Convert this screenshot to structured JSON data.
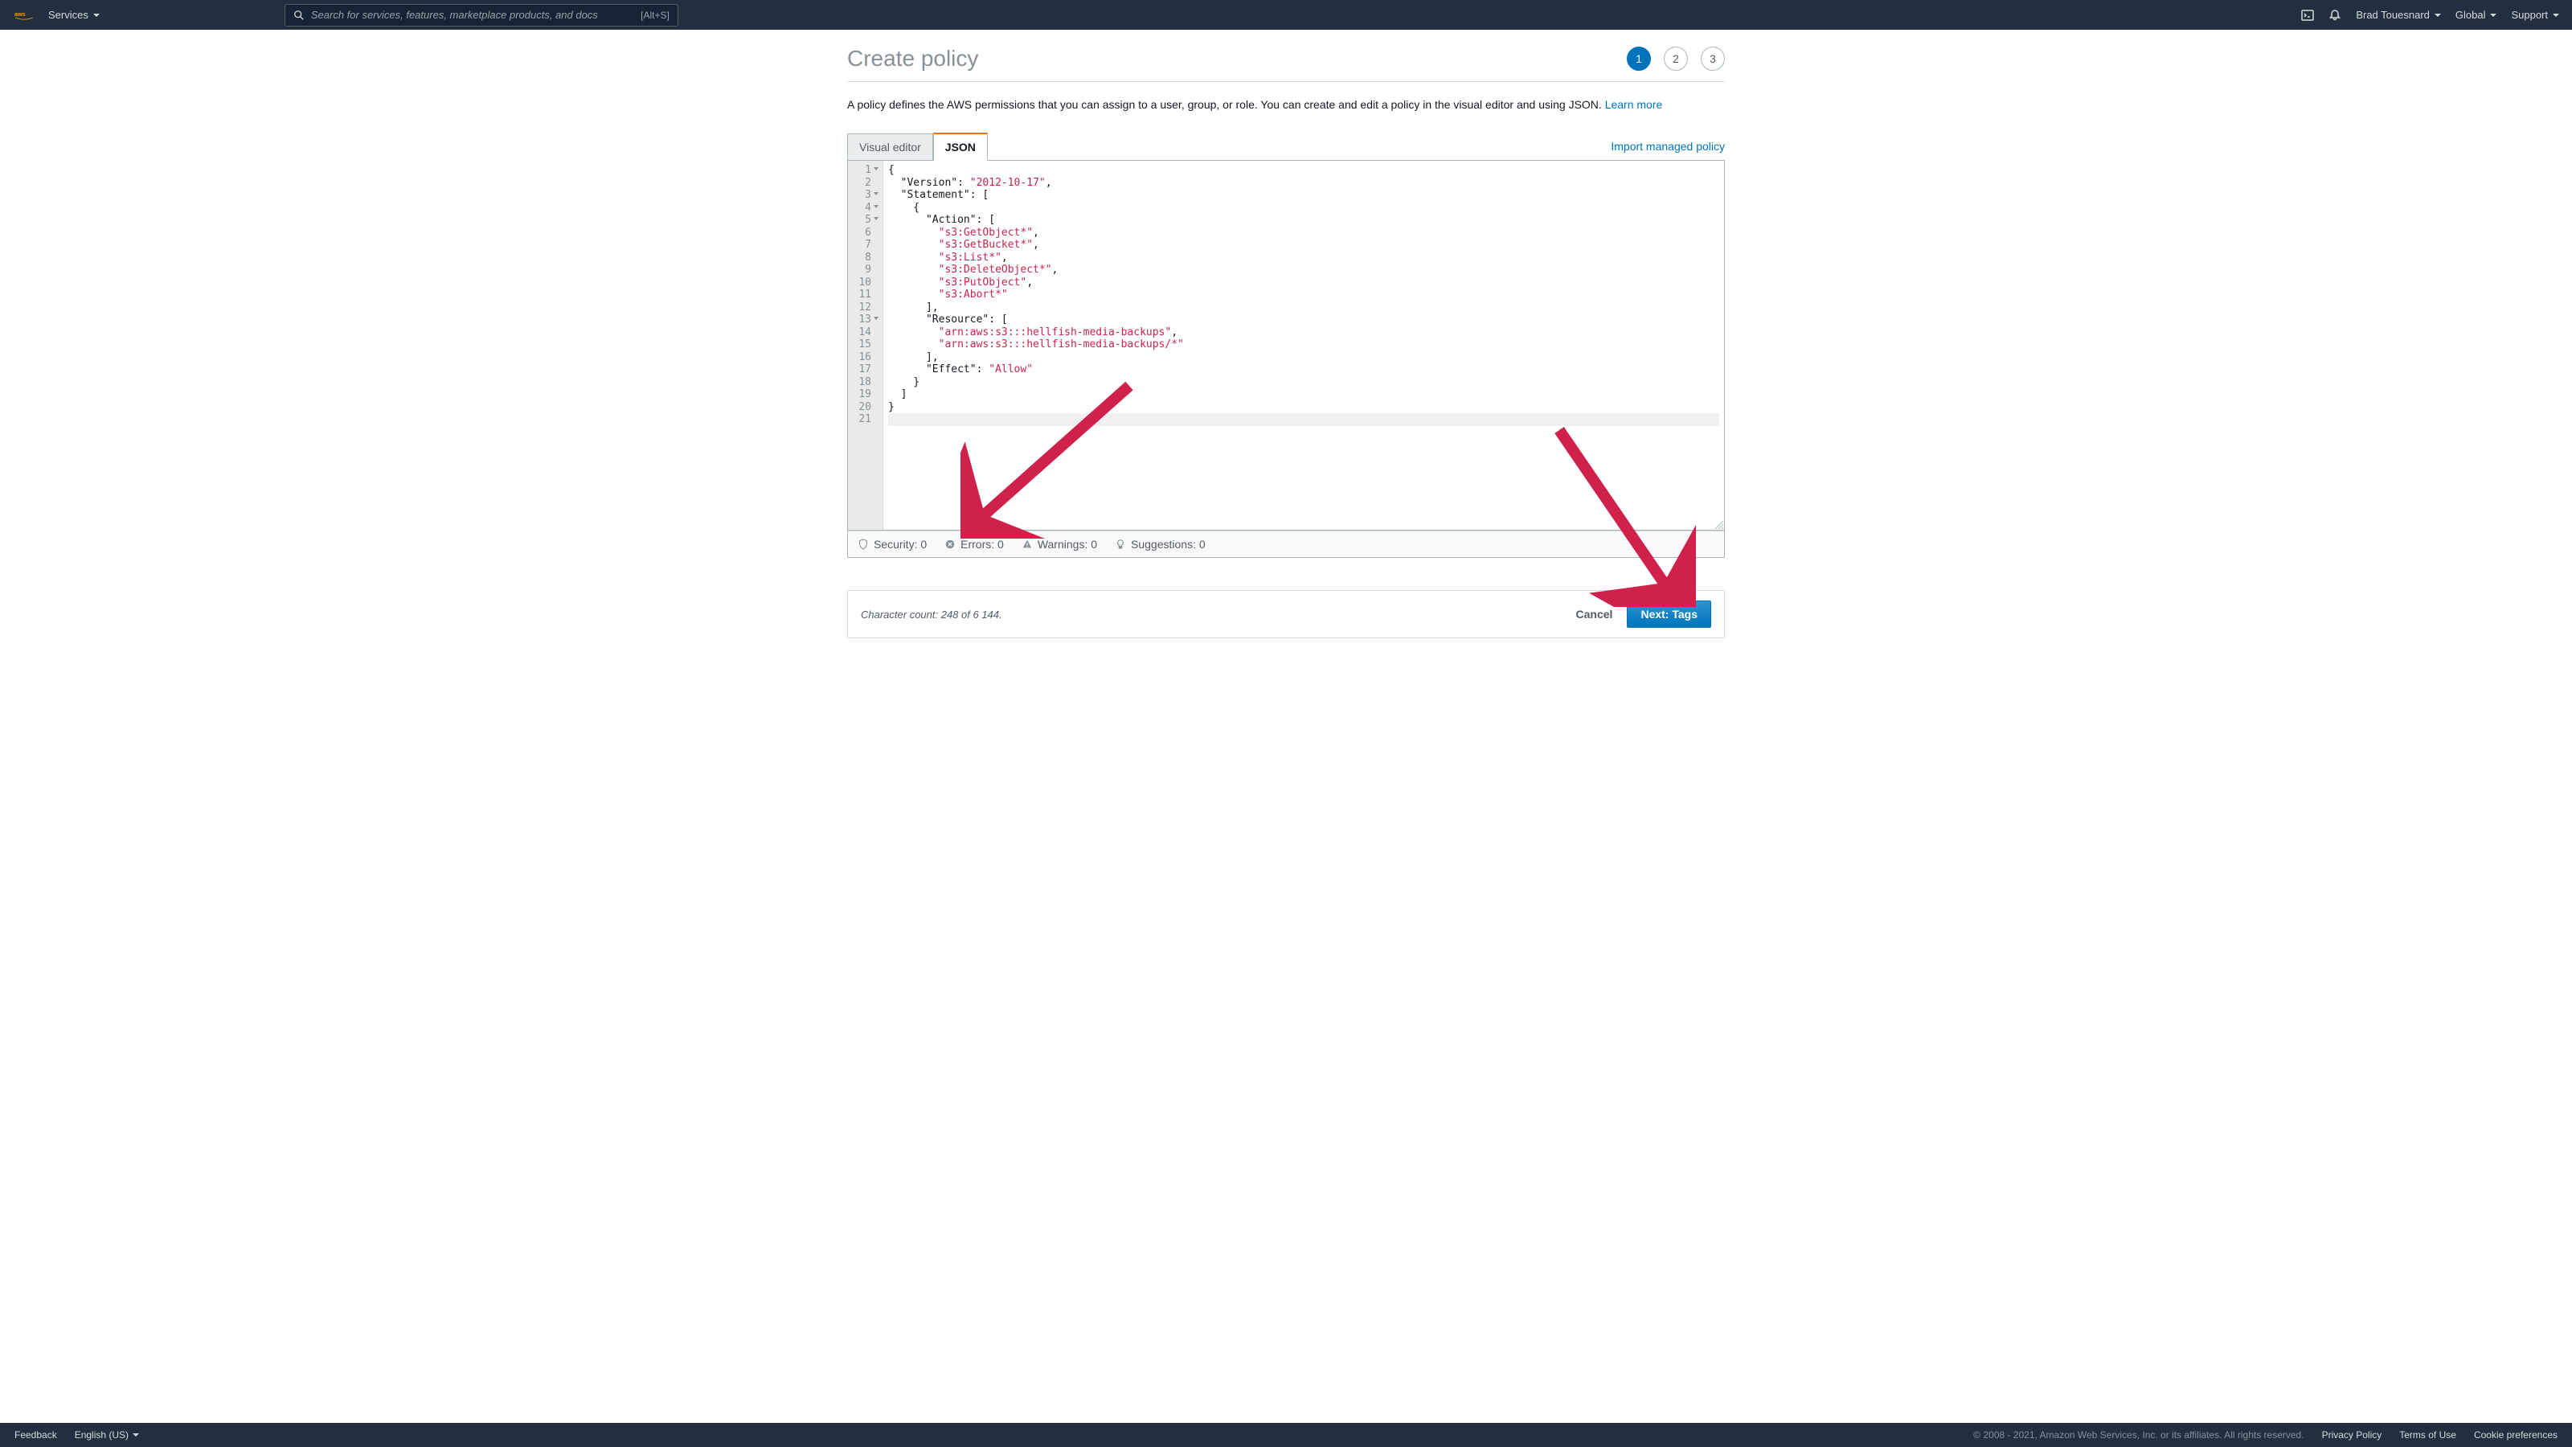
{
  "nav": {
    "services": "Services",
    "search_placeholder": "Search for services, features, marketplace products, and docs",
    "search_hint": "[Alt+S]",
    "user": "Brad Touesnard",
    "region": "Global",
    "support": "Support"
  },
  "page": {
    "title": "Create policy",
    "steps": [
      "1",
      "2",
      "3"
    ],
    "active_step": 0,
    "description": "A policy defines the AWS permissions that you can assign to a user, group, or role. You can create and edit a policy in the visual editor and using JSON. ",
    "learn_more": "Learn more"
  },
  "tabs": {
    "visual": "Visual editor",
    "json": "JSON",
    "import": "Import managed policy"
  },
  "editor": {
    "line_count": 21,
    "fold_lines": [
      1,
      3,
      4,
      5,
      13
    ],
    "highlight_line": 21,
    "code_lines": [
      [
        {
          "t": "{",
          "c": "k"
        }
      ],
      [
        {
          "t": "  ",
          "c": "k"
        },
        {
          "t": "\"Version\"",
          "c": "k"
        },
        {
          "t": ": ",
          "c": "k"
        },
        {
          "t": "\"2012-10-17\"",
          "c": "s"
        },
        {
          "t": ",",
          "c": "k"
        }
      ],
      [
        {
          "t": "  ",
          "c": "k"
        },
        {
          "t": "\"Statement\"",
          "c": "k"
        },
        {
          "t": ": [",
          "c": "k"
        }
      ],
      [
        {
          "t": "    {",
          "c": "k"
        }
      ],
      [
        {
          "t": "      ",
          "c": "k"
        },
        {
          "t": "\"Action\"",
          "c": "k"
        },
        {
          "t": ": [",
          "c": "k"
        }
      ],
      [
        {
          "t": "        ",
          "c": "k"
        },
        {
          "t": "\"s3:GetObject*\"",
          "c": "s"
        },
        {
          "t": ",",
          "c": "k"
        }
      ],
      [
        {
          "t": "        ",
          "c": "k"
        },
        {
          "t": "\"s3:GetBucket*\"",
          "c": "s"
        },
        {
          "t": ",",
          "c": "k"
        }
      ],
      [
        {
          "t": "        ",
          "c": "k"
        },
        {
          "t": "\"s3:List*\"",
          "c": "s"
        },
        {
          "t": ",",
          "c": "k"
        }
      ],
      [
        {
          "t": "        ",
          "c": "k"
        },
        {
          "t": "\"s3:DeleteObject*\"",
          "c": "s"
        },
        {
          "t": ",",
          "c": "k"
        }
      ],
      [
        {
          "t": "        ",
          "c": "k"
        },
        {
          "t": "\"s3:PutObject\"",
          "c": "s"
        },
        {
          "t": ",",
          "c": "k"
        }
      ],
      [
        {
          "t": "        ",
          "c": "k"
        },
        {
          "t": "\"s3:Abort*\"",
          "c": "s"
        }
      ],
      [
        {
          "t": "      ],",
          "c": "k"
        }
      ],
      [
        {
          "t": "      ",
          "c": "k"
        },
        {
          "t": "\"Resource\"",
          "c": "k"
        },
        {
          "t": ": [",
          "c": "k"
        }
      ],
      [
        {
          "t": "        ",
          "c": "k"
        },
        {
          "t": "\"arn:aws:s3:::hellfish-media-backups\"",
          "c": "s"
        },
        {
          "t": ",",
          "c": "k"
        }
      ],
      [
        {
          "t": "        ",
          "c": "k"
        },
        {
          "t": "\"arn:aws:s3:::hellfish-media-backups/*\"",
          "c": "s"
        }
      ],
      [
        {
          "t": "      ],",
          "c": "k"
        }
      ],
      [
        {
          "t": "      ",
          "c": "k"
        },
        {
          "t": "\"Effect\"",
          "c": "k"
        },
        {
          "t": ": ",
          "c": "k"
        },
        {
          "t": "\"Allow\"",
          "c": "s"
        }
      ],
      [
        {
          "t": "    }",
          "c": "k"
        }
      ],
      [
        {
          "t": "  ]",
          "c": "k"
        }
      ],
      [
        {
          "t": "}",
          "c": "k"
        }
      ],
      [
        {
          "t": "",
          "c": "k"
        }
      ]
    ]
  },
  "status": {
    "security": "Security: 0",
    "errors": "Errors: 0",
    "warnings": "Warnings: 0",
    "suggestions": "Suggestions: 0"
  },
  "footer": {
    "char_count": "Character count: 248 of 6 144.",
    "cancel": "Cancel",
    "next": "Next: Tags"
  },
  "bottom": {
    "feedback": "Feedback",
    "language": "English (US)",
    "copyright": "© 2008 - 2021, Amazon Web Services, Inc. or its affiliates. All rights reserved.",
    "privacy": "Privacy Policy",
    "terms": "Terms of Use",
    "prefs": "Cookie preferences"
  }
}
